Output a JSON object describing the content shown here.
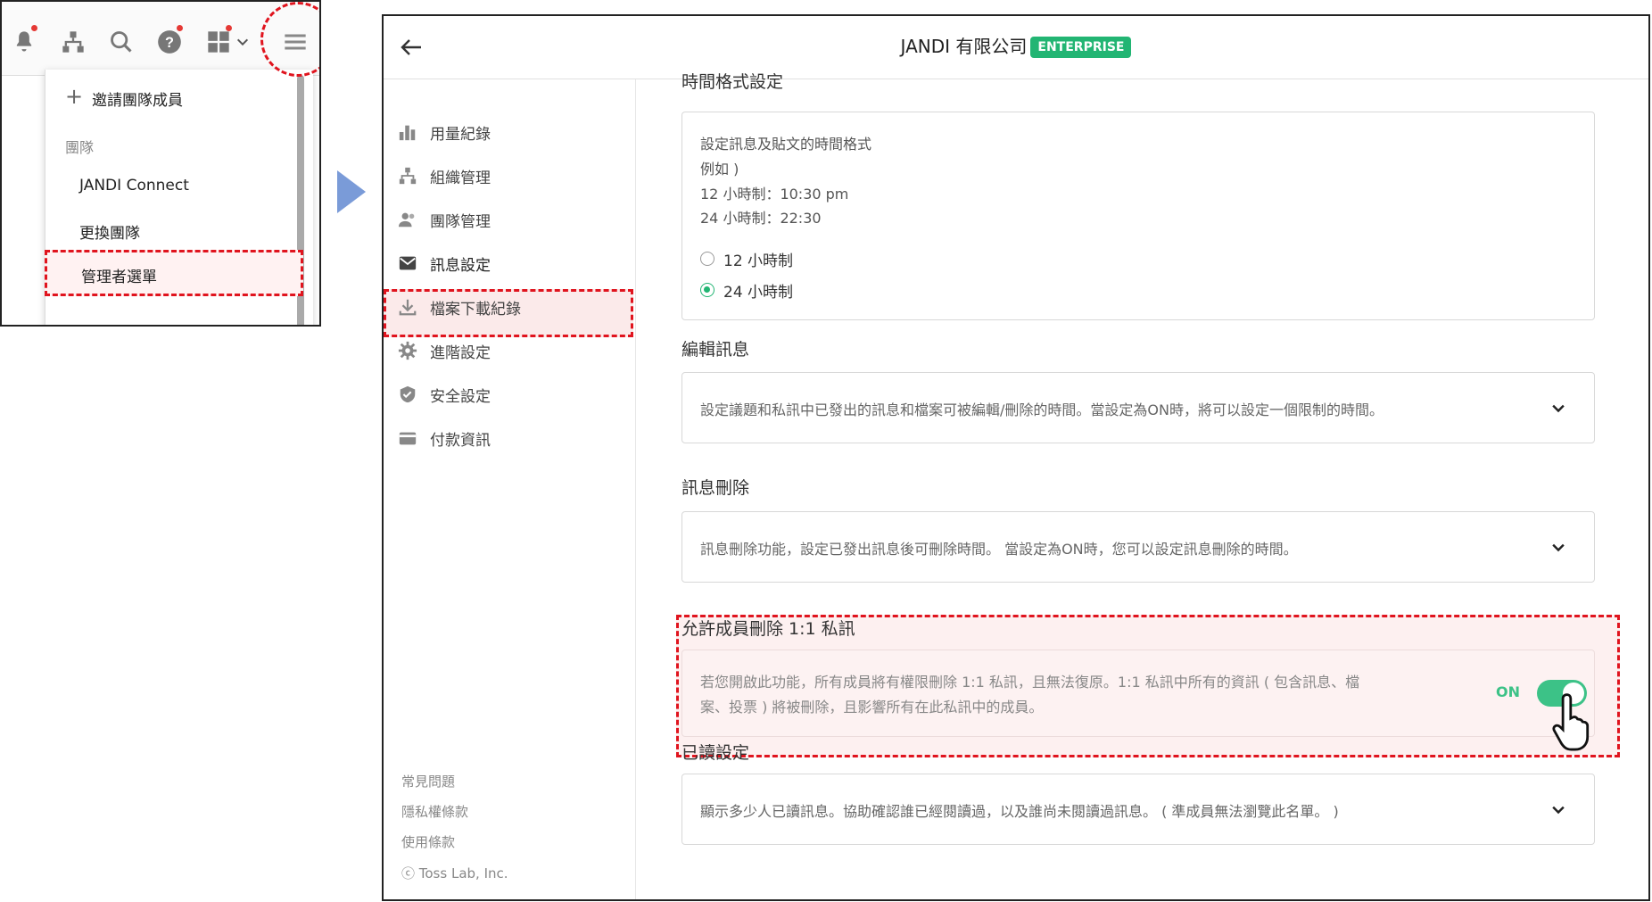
{
  "left_panel": {
    "dropdown": {
      "invite_label": "邀請團隊成員",
      "team_section": "團隊",
      "jandi_connect": "JANDI Connect",
      "switch_team": "更換團隊",
      "admin_menu": "管理者選單"
    },
    "icons": [
      "bell-icon",
      "org-chart-icon",
      "search-icon",
      "help-icon",
      "apps-grid-icon",
      "menu-icon"
    ]
  },
  "right_panel": {
    "header": {
      "company": "JANDI 有限公司",
      "badge": "ENTERPRISE",
      "badge_color": "#22b573"
    },
    "sidebar": {
      "items": [
        {
          "label": "用量紀錄",
          "icon": "bar-chart-icon"
        },
        {
          "label": "組織管理",
          "icon": "org-chart-icon"
        },
        {
          "label": "團隊管理",
          "icon": "users-icon"
        },
        {
          "label": "訊息設定",
          "icon": "envelope-icon",
          "active": true
        },
        {
          "label": "檔案下載紀錄",
          "icon": "download-icon"
        },
        {
          "label": "進階設定",
          "icon": "gear-icon"
        },
        {
          "label": "安全設定",
          "icon": "shield-icon"
        },
        {
          "label": "付款資訊",
          "icon": "card-icon"
        }
      ],
      "footer": {
        "faq": "常見問題",
        "privacy": "隱私權條款",
        "terms": "使用條款",
        "copyright": "ⓒ Toss Lab, Inc."
      }
    },
    "content": {
      "time_format": {
        "title_partial": "時間格式設定",
        "desc": "設定訊息及貼文的時間格式",
        "example": "例如 )",
        "ex12": "12 小時制：10:30 pm",
        "ex24": "24 小時制：22:30",
        "option12": "12 小時制",
        "option24": "24 小時制",
        "selected": "24 小時制"
      },
      "edit_message": {
        "title": "編輯訊息",
        "desc": "設定議題和私訊中已發出的訊息和檔案可被編輯/刪除的時間。當設定為ON時，將可以設定一個限制的時間。"
      },
      "delete_message": {
        "title": "訊息刪除",
        "desc": "訊息刪除功能，設定已發出訊息後可刪除時間。 當設定為ON時，您可以設定訊息刪除的時間。"
      },
      "allow_delete_dm": {
        "title": "允許成員刪除 1:1 私訊",
        "desc_line1": "若您開啟此功能，所有成員將有權限刪除 1:1 私訊，且無法復原。1:1 私訊中所有的資訊 ( 包含訊息、檔",
        "desc_line2": "案、投票 ) 將被刪除，且影響所有在此私訊中的成員。",
        "toggle_label": "ON",
        "toggle_on": true,
        "toggle_color": "#3cc287"
      },
      "read_setting": {
        "title": "已讀設定",
        "desc": "顯示多少人已讀訊息。協助確認誰已經閱讀過，以及誰尚未閱讀過訊息。 ( 準成員無法瀏覽此名單。 )"
      }
    }
  },
  "accent_red": "#e0141e"
}
